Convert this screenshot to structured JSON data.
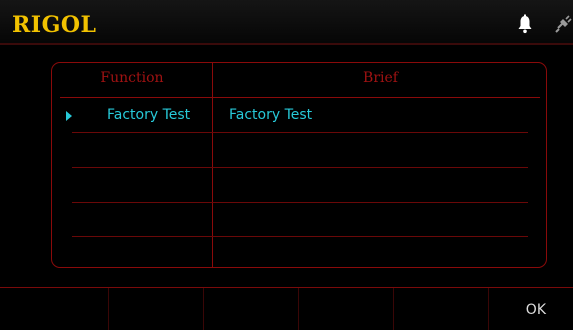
{
  "header": {
    "logo": "RIGOL",
    "status_icons": [
      "bell-icon",
      "plug-icon"
    ]
  },
  "table": {
    "columns": [
      "Function",
      "Brief"
    ],
    "rows": [
      {
        "function": "Factory Test",
        "brief": "Factory Test",
        "selected": true
      },
      {
        "function": "",
        "brief": ""
      },
      {
        "function": "",
        "brief": ""
      },
      {
        "function": "",
        "brief": ""
      },
      {
        "function": "",
        "brief": ""
      }
    ]
  },
  "softkeys": [
    "",
    "",
    "",
    "",
    "",
    "OK"
  ],
  "colors": {
    "logo": "#f2c200",
    "border": "#8a0a0a",
    "header_text": "#a01212",
    "row_text": "#27c9d8",
    "softkey_text": "#dddddd"
  }
}
